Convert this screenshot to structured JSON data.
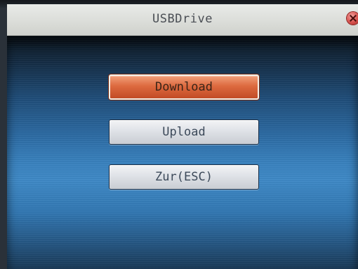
{
  "window": {
    "title": "USBDrive"
  },
  "menu": {
    "items": [
      {
        "label": "Download",
        "selected": true
      },
      {
        "label": "Upload",
        "selected": false
      },
      {
        "label": "Zur(ESC)",
        "selected": false
      }
    ]
  },
  "icons": {
    "close": "close-icon"
  },
  "colors": {
    "selected_button": "#dd6a3f",
    "button": "#dfe2e7",
    "background": "#3a83c0",
    "titlebar": "#dadcd8"
  }
}
